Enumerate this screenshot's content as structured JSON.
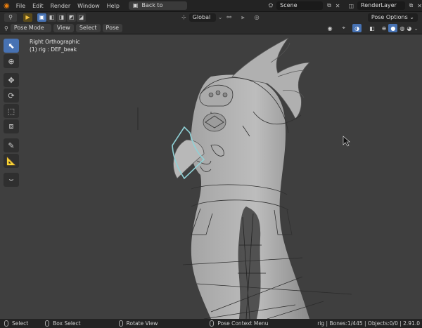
{
  "topbar": {
    "menus": [
      "File",
      "Edit",
      "Render",
      "Window",
      "Help"
    ],
    "back_button": "Back to Previous",
    "scene": "Scene",
    "render_layer": "RenderLayer"
  },
  "header": {
    "orientation": "Global",
    "pose_options": "Pose Options"
  },
  "header2": {
    "mode": "Pose Mode",
    "menus": [
      "View",
      "Select",
      "Pose"
    ]
  },
  "viewport": {
    "view_name": "Right Orthographic",
    "active": "(1) rig : DEF_beak"
  },
  "status": {
    "select": "Select",
    "box_select": "Box Select",
    "rotate_view": "Rotate View",
    "context_menu": "Pose Context Menu",
    "stats": "rig | Bones:1/445 | Objects:0/0 | 2.91.0"
  },
  "colors": {
    "accent": "#4772b3",
    "selected_bone": "#8fd1d6"
  }
}
